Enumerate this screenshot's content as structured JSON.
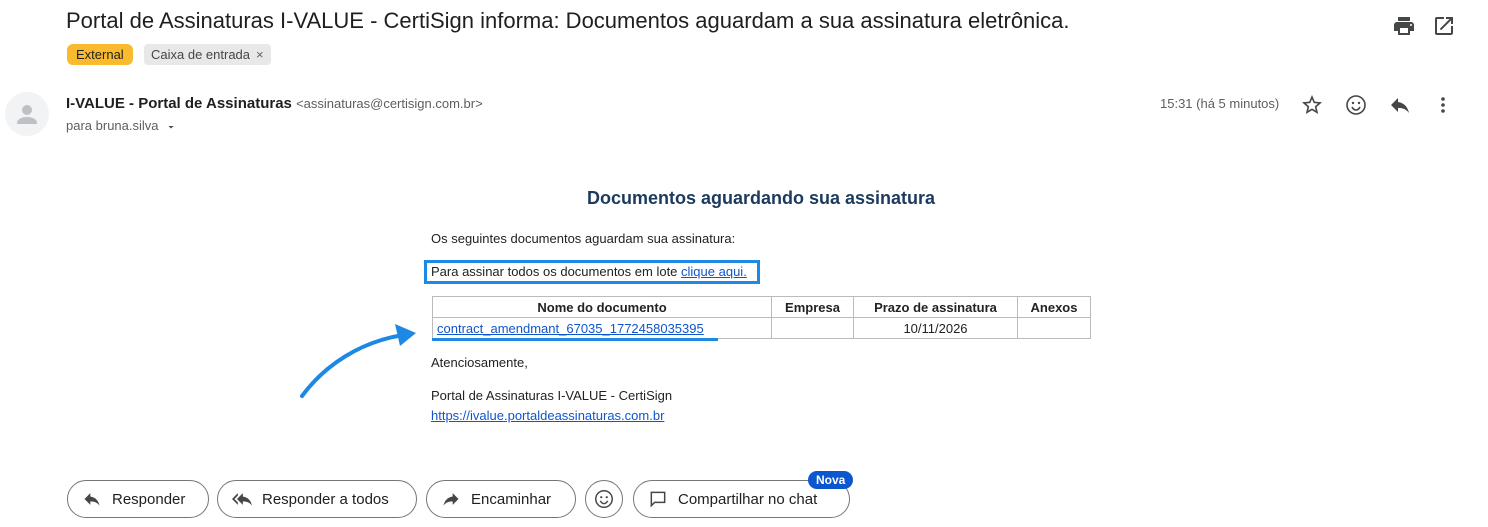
{
  "email": {
    "subject": "Portal de Assinaturas I-VALUE - CertiSign informa: Documentos aguardam a sua assinatura eletrônica.",
    "labels": {
      "external": "External",
      "inbox": "Caixa de entrada",
      "inbox_remove": "×"
    },
    "sender_name": "I-VALUE - Portal de Assinaturas",
    "sender_email": "<assinaturas@certisign.com.br>",
    "to": "para bruna.silva",
    "time": "15:31 (há 5 minutos)"
  },
  "body": {
    "title": "Documentos aguardando sua assinatura",
    "intro": "Os seguintes documentos aguardam sua assinatura:",
    "batch_text": "Para assinar todos os documentos em lote ",
    "batch_link": "clique aqui.",
    "table": {
      "headers": [
        "Nome do documento",
        "Empresa",
        "Prazo de assinatura",
        "Anexos"
      ],
      "rows": [
        {
          "name": "contract_amendmant_67035_1772458035395",
          "company": "",
          "deadline": "10/11/2026",
          "attachments": ""
        }
      ]
    },
    "closing": "Atenciosamente,",
    "signature": "Portal de Assinaturas I-VALUE - CertiSign",
    "portal_link": "https://ivalue.portaldeassinaturas.com.br"
  },
  "actions": {
    "reply": "Responder",
    "reply_all": "Responder a todos",
    "forward": "Encaminhar",
    "share_chat": "Compartilhar no chat",
    "new_badge": "Nova"
  },
  "icons": [
    "print-icon",
    "open-in-new-icon",
    "star-icon",
    "emoji-icon",
    "reply-icon",
    "more-vert-icon",
    "reply-all-icon",
    "forward-icon",
    "chat-icon",
    "dropdown-icon",
    "avatar-person-icon",
    "annotation-arrow"
  ],
  "colors": {
    "external_chip": "#f9bb2d",
    "highlight": "#1e88e5",
    "link": "#1155cc",
    "badge": "#0b57d0"
  }
}
